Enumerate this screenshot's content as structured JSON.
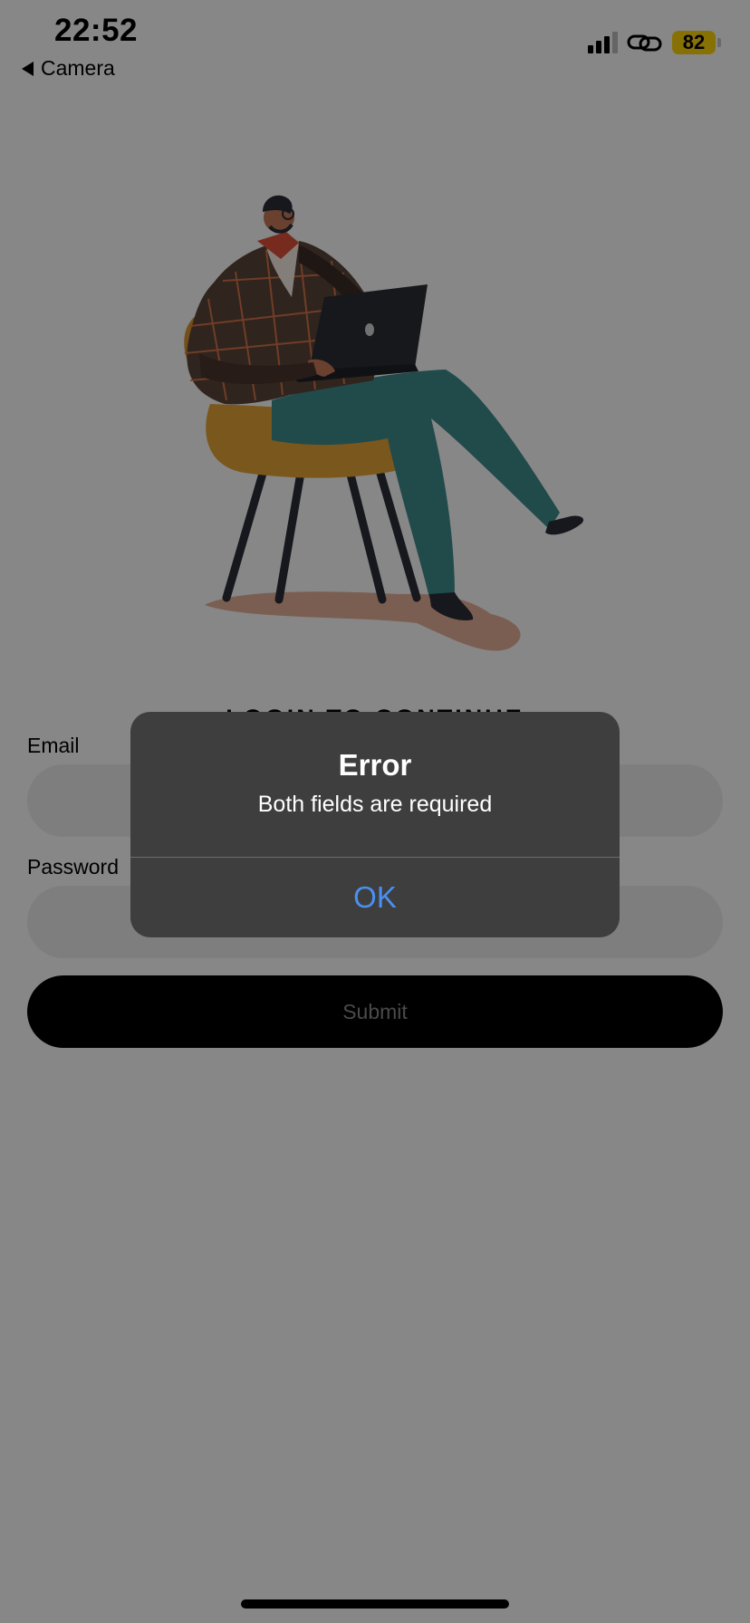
{
  "status_bar": {
    "time": "22:52",
    "back_label": "Camera",
    "battery_level": "82",
    "signal_strength": "3 of 4 bars",
    "icons": [
      "signal-icon",
      "link-icon",
      "battery-icon"
    ]
  },
  "login": {
    "heading": "LOGIN TO CONTINUE",
    "email_label": "Email",
    "email_value": "",
    "password_label": "Password",
    "password_value": "",
    "submit_label": "Submit"
  },
  "alert": {
    "title": "Error",
    "message": "Both fields are required",
    "ok_label": "OK"
  },
  "colors": {
    "alert_background": "#3e3e3e",
    "alert_button": "#4a90f0",
    "battery": "#ffd60a",
    "submit_button": "#000000"
  }
}
